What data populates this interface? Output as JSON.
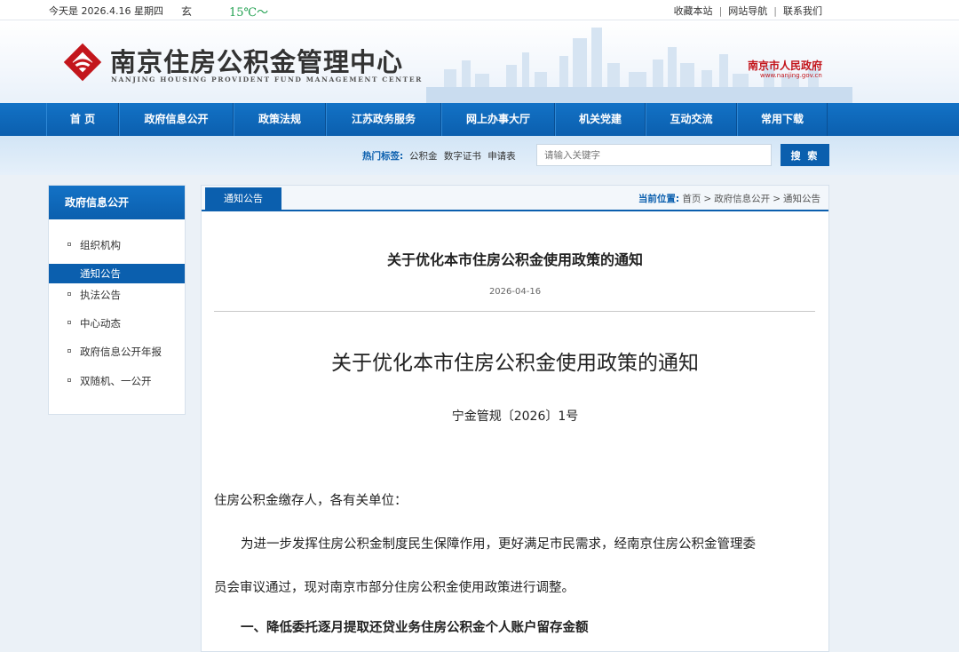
{
  "topbar": {
    "date": "今天是 2026.4.16 星期四",
    "weather_city": "玄",
    "weather_temp": "15℃～",
    "links": [
      "收藏本站",
      "网站导航",
      "联系我们"
    ]
  },
  "header": {
    "site_title": "南京住房公积金管理中心",
    "site_subtitle": "NANJING HOUSING PROVIDENT FUND MANAGEMENT CENTER",
    "gov_title": "南京市人民政府",
    "gov_url": "www.nanjing.gov.cn"
  },
  "nav": {
    "items": [
      "首 页",
      "政府信息公开",
      "政策法规",
      "江苏政务服务",
      "网上办事大厅",
      "机关党建",
      "互动交流",
      "常用下载"
    ]
  },
  "search": {
    "hot_label": "热门标签:",
    "hot_tags": [
      "公积金",
      "数字证书",
      "申请表"
    ],
    "placeholder": "请输入关键字",
    "button_label": "搜 索"
  },
  "sidebar": {
    "title": "政府信息公开",
    "items": [
      {
        "label": "组织机构",
        "active": false
      },
      {
        "label": "通知公告",
        "active": true
      },
      {
        "label": "执法公告",
        "active": false
      },
      {
        "label": "中心动态",
        "active": false
      },
      {
        "label": "政府信息公开年报",
        "active": false
      },
      {
        "label": "双随机、一公开",
        "active": false
      }
    ]
  },
  "content": {
    "tab_label": "通知公告",
    "breadcrumb": {
      "label": "当前位置:",
      "path": [
        "首页",
        "政府信息公开",
        "通知公告"
      ]
    },
    "article_title": "关于优化本市住房公积金使用政策的通知",
    "article_date": "2026-04-16",
    "doc_title": "关于优化本市住房公积金使用政策的通知",
    "doc_number": "宁金管规〔2026〕1号",
    "salutation": "住房公积金缴存人，各有关单位：",
    "para1_line1": "为进一步发挥住房公积金制度民生保障作用，更好满足市民需求，经南京住房公积金管理委",
    "para1_line2": "员会审议通过，现对南京市部分住房公积金使用政策进行调整。",
    "section1": "一、降低委托逐月提取还贷业务住房公积金个人账户留存金额"
  }
}
